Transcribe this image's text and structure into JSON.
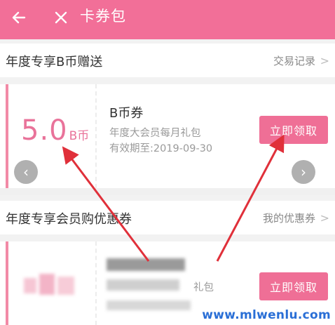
{
  "header": {
    "title": "卡券包",
    "back_icon": "arrow-left-icon",
    "close_icon": "close-icon",
    "background": "#f26f98"
  },
  "section1": {
    "title": "年度专享B币赠送",
    "link": "交易记录"
  },
  "coupon1": {
    "amount": "5.0",
    "unit": "B币",
    "name": "B币券",
    "desc": "年度大会员每月礼包",
    "validity": "有效期至:2019-09-30",
    "button": "立即领取"
  },
  "section2": {
    "title": "年度专享会员购优惠券",
    "link": "我的优惠券"
  },
  "coupon2": {
    "partial_text": "礼包",
    "button": "立即领取"
  },
  "watermark": "www.mlwenlu.com",
  "colors": {
    "accent": "#f26f98",
    "annotation": "#e0303a"
  }
}
